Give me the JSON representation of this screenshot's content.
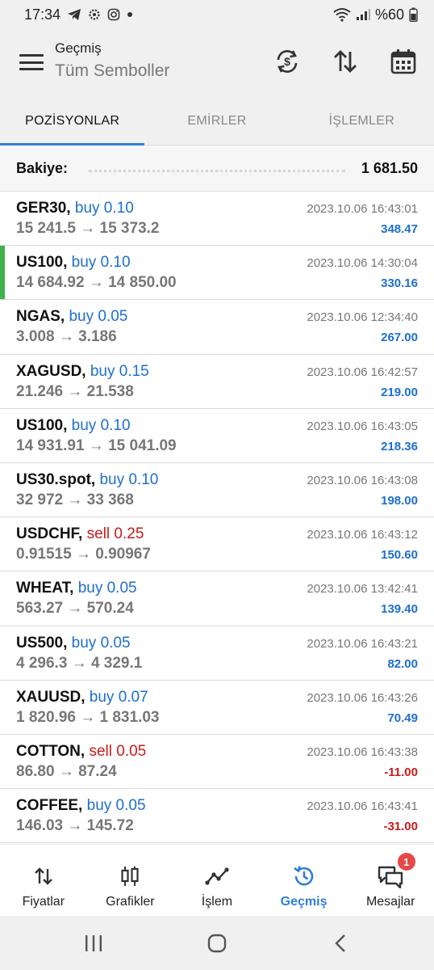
{
  "status_bar": {
    "time": "17:34",
    "battery": "%60",
    "icons": [
      "telegram-icon",
      "gear-icon",
      "instagram-icon",
      "dot-icon",
      "wifi-icon",
      "signal-icon",
      "battery-icon"
    ]
  },
  "header": {
    "subtitle": "Geçmiş",
    "title": "Tüm Semboller",
    "icons": [
      "menu-icon",
      "currency-exchange-icon",
      "sort-icon",
      "calendar-icon"
    ]
  },
  "tabs": [
    {
      "label": "POZİSYONLAR",
      "active": true
    },
    {
      "label": "EMİRLER",
      "active": false
    },
    {
      "label": "İŞLEMLER",
      "active": false
    }
  ],
  "balance": {
    "label": "Bakiye:",
    "value": "1 681.50"
  },
  "positions": [
    {
      "symbol": "GER30,",
      "side": "buy 0.10",
      "side_type": "buy",
      "prices": "15 241.5 → 15 373.2",
      "time": "2023.10.06 16:43:01",
      "profit": "348.47",
      "profit_type": "pos"
    },
    {
      "symbol": "US100,",
      "side": "buy 0.10",
      "side_type": "buy",
      "prices": "14 684.92 → 14 850.00",
      "time": "2023.10.06 14:30:04",
      "profit": "330.16",
      "profit_type": "pos"
    },
    {
      "symbol": "NGAS,",
      "side": "buy 0.05",
      "side_type": "buy",
      "prices": "3.008 → 3.186",
      "time": "2023.10.06 12:34:40",
      "profit": "267.00",
      "profit_type": "pos"
    },
    {
      "symbol": "XAGUSD,",
      "side": "buy 0.15",
      "side_type": "buy",
      "prices": "21.246 → 21.538",
      "time": "2023.10.06 16:42:57",
      "profit": "219.00",
      "profit_type": "pos"
    },
    {
      "symbol": "US100,",
      "side": "buy 0.10",
      "side_type": "buy",
      "prices": "14 931.91 → 15 041.09",
      "time": "2023.10.06 16:43:05",
      "profit": "218.36",
      "profit_type": "pos"
    },
    {
      "symbol": "US30.spot,",
      "side": "buy 0.10",
      "side_type": "buy",
      "prices": "32 972 → 33 368",
      "time": "2023.10.06 16:43:08",
      "profit": "198.00",
      "profit_type": "pos"
    },
    {
      "symbol": "USDCHF,",
      "side": "sell 0.25",
      "side_type": "sell",
      "prices": "0.91515 → 0.90967",
      "time": "2023.10.06 16:43:12",
      "profit": "150.60",
      "profit_type": "pos"
    },
    {
      "symbol": "WHEAT,",
      "side": "buy 0.05",
      "side_type": "buy",
      "prices": "563.27 → 570.24",
      "time": "2023.10.06 13:42:41",
      "profit": "139.40",
      "profit_type": "pos"
    },
    {
      "symbol": "US500,",
      "side": "buy 0.05",
      "side_type": "buy",
      "prices": "4 296.3 → 4 329.1",
      "time": "2023.10.06 16:43:21",
      "profit": "82.00",
      "profit_type": "pos"
    },
    {
      "symbol": "XAUUSD,",
      "side": "buy 0.07",
      "side_type": "buy",
      "prices": "1 820.96 → 1 831.03",
      "time": "2023.10.06 16:43:26",
      "profit": "70.49",
      "profit_type": "pos"
    },
    {
      "symbol": "COTTON,",
      "side": "sell 0.05",
      "side_type": "sell",
      "prices": "86.80 → 87.24",
      "time": "2023.10.06 16:43:38",
      "profit": "-11.00",
      "profit_type": "neg"
    },
    {
      "symbol": "COFFEE,",
      "side": "buy 0.05",
      "side_type": "buy",
      "prices": "146.03 → 145.72",
      "time": "2023.10.06 16:43:41",
      "profit": "-31.00",
      "profit_type": "neg"
    }
  ],
  "bottom_nav": [
    {
      "label": "Fiyatlar",
      "icon": "quotes-icon",
      "active": false
    },
    {
      "label": "Grafikler",
      "icon": "candlestick-icon",
      "active": false
    },
    {
      "label": "İşlem",
      "icon": "trade-line-icon",
      "active": false
    },
    {
      "label": "Geçmiş",
      "icon": "history-icon",
      "active": true
    },
    {
      "label": "Mesajlar",
      "icon": "messages-icon",
      "active": false,
      "badge": "1"
    }
  ],
  "colors": {
    "accent": "#2f7fd8",
    "buy": "#1d6fd0",
    "sell": "#cc1a1a",
    "highlight_bar": "#3fb24a"
  }
}
